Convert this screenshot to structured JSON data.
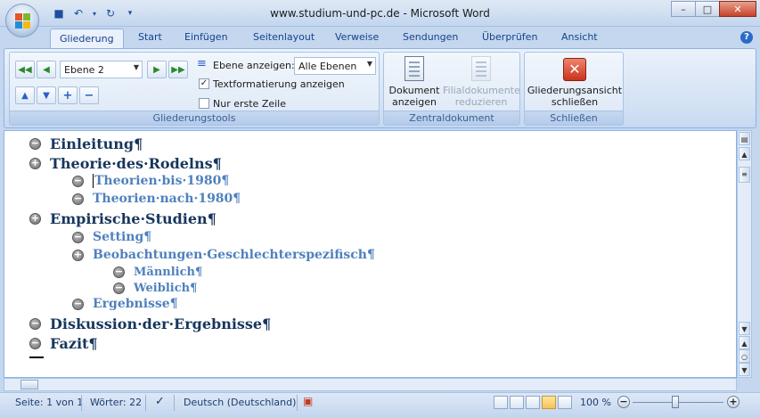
{
  "window": {
    "title": "www.studium-und-pc.de - Microsoft Word",
    "controls": {
      "minimize": "–",
      "maximize": "□",
      "close": "✕"
    }
  },
  "quick_access": [
    {
      "name": "save-icon",
      "glyph": "💾"
    },
    {
      "name": "undo-icon",
      "glyph": "↶"
    },
    {
      "name": "redo-icon",
      "glyph": "↷"
    },
    {
      "name": "customize-icon",
      "glyph": "▾"
    }
  ],
  "tabs": [
    "Gliederung",
    "Start",
    "Einfügen",
    "Seitenlayout",
    "Verweise",
    "Sendungen",
    "Überprüfen",
    "Ansicht"
  ],
  "help": "?",
  "ribbon": {
    "gliederungstools": {
      "label": "Gliederungstools",
      "level_select": "Ebene 2",
      "show_level_label": "Ebene anzeigen:",
      "show_level_value": "Alle Ebenen",
      "text_formatting_label": "Textformatierung anzeigen",
      "text_formatting_checked": true,
      "first_line_label": "Nur erste Zeile",
      "first_line_checked": false
    },
    "zentraldokument": {
      "label": "Zentraldokument",
      "show_document_l1": "Dokument",
      "show_document_l2": "anzeigen",
      "collapse_sub_l1": "Filialdokumente",
      "collapse_sub_l2": "reduzieren"
    },
    "schliessen": {
      "label": "Schließen",
      "close_outline_l1": "Gliederungsansicht",
      "close_outline_l2": "schließen"
    }
  },
  "outline": [
    {
      "level": 1,
      "symbol": "−",
      "text": "Einleitung¶"
    },
    {
      "level": 1,
      "symbol": "+",
      "text": "Theorie·des·Rodelns¶"
    },
    {
      "level": 2,
      "symbol": "−",
      "text": "Theorien·bis·1980¶",
      "cursor": true
    },
    {
      "level": 2,
      "symbol": "−",
      "text": "Theorien·nach·1980¶"
    },
    {
      "level": 1,
      "symbol": "+",
      "text": "Empirische·Studien¶"
    },
    {
      "level": 2,
      "symbol": "−",
      "text": "Setting¶"
    },
    {
      "level": 2,
      "symbol": "+",
      "text": "Beobachtungen·Geschlechterspezifisch¶"
    },
    {
      "level": 3,
      "symbol": "−",
      "text": "Männlich¶"
    },
    {
      "level": 3,
      "symbol": "−",
      "text": "Weiblich¶"
    },
    {
      "level": 2,
      "symbol": "−",
      "text": "Ergebnisse¶"
    },
    {
      "level": 1,
      "symbol": "−",
      "text": "Diskussion·der·Ergebnisse¶"
    },
    {
      "level": 1,
      "symbol": "−",
      "text": "Fazit¶"
    }
  ],
  "status": {
    "page": "Seite: 1 von 1",
    "words": "Wörter: 22",
    "language": "Deutsch (Deutschland)",
    "zoom": "100 %",
    "zoom_minus": "−",
    "zoom_plus": "+"
  }
}
